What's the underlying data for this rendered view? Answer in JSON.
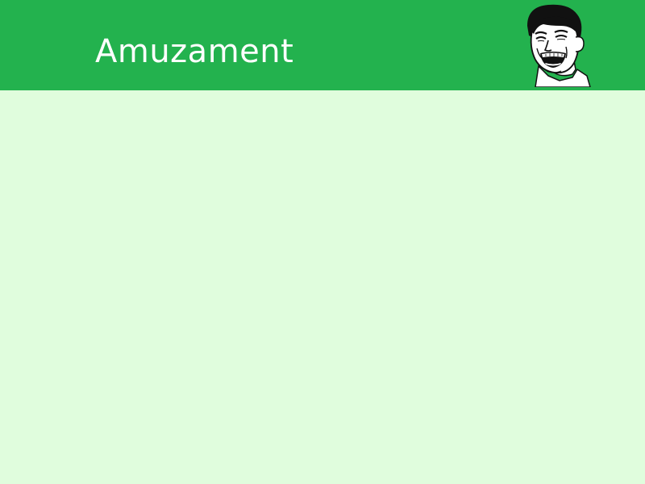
{
  "slide": {
    "title": "Amuzament",
    "header_color": "#23b24e",
    "background_color": "#e0fddd",
    "image": "laughing-face-meme-icon"
  }
}
